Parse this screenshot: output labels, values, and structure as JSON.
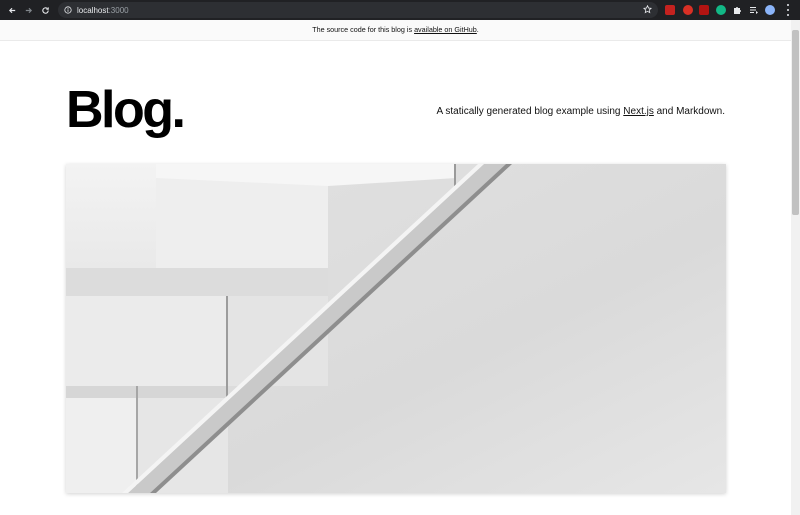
{
  "browser": {
    "url_host": "localhost",
    "url_port": ":3000",
    "icons": {
      "back": "arrow-left-icon",
      "forward": "arrow-right-icon",
      "reload": "reload-icon",
      "info": "info-icon",
      "bookmark": "star-icon",
      "menu": "more-vertical-icon"
    },
    "extensions": [
      {
        "name": "extension-1",
        "color": "#c5221f"
      },
      {
        "name": "extension-2",
        "color": "#d93025"
      },
      {
        "name": "extension-3",
        "color": "#b31412"
      },
      {
        "name": "extension-4",
        "color": "#12b886"
      }
    ]
  },
  "alert": {
    "text_before": "The source code for this blog is ",
    "link_text": "available on GitHub",
    "text_after": "."
  },
  "intro": {
    "title": "Blog.",
    "tagline_before": "A statically generated blog example using ",
    "tagline_link": "Next.js",
    "tagline_after": " and Markdown."
  },
  "hero": {
    "image": "cover-image"
  }
}
